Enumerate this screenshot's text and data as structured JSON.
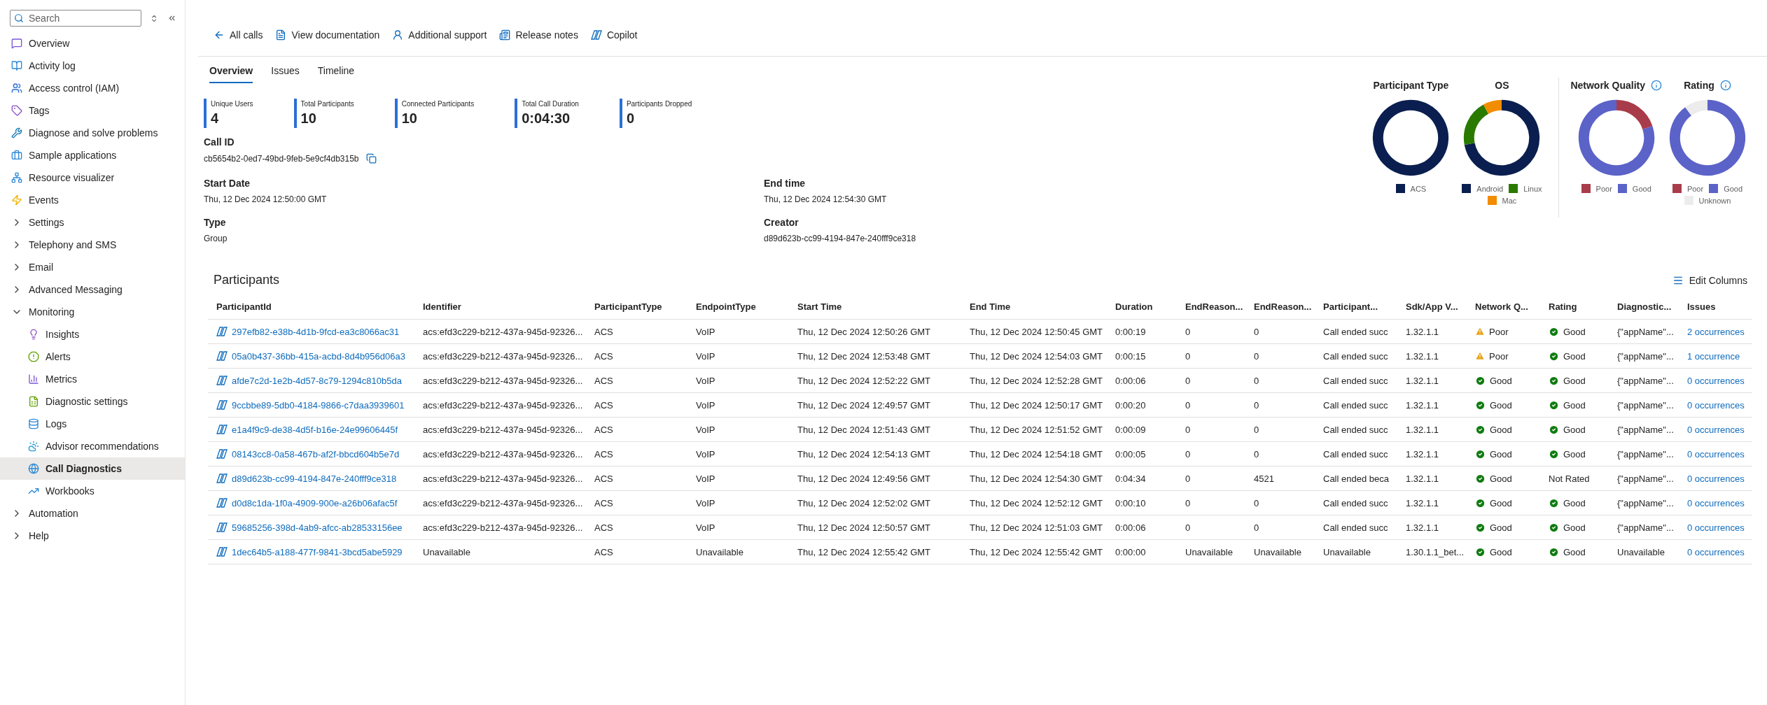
{
  "sidebar": {
    "search": {
      "placeholder": "Search"
    },
    "items": [
      {
        "label": "Overview",
        "kind": "link",
        "selected": false
      },
      {
        "label": "Activity log",
        "kind": "link",
        "selected": false
      },
      {
        "label": "Access control (IAM)",
        "kind": "link",
        "selected": false
      },
      {
        "label": "Tags",
        "kind": "link",
        "selected": false
      },
      {
        "label": "Diagnose and solve problems",
        "kind": "link",
        "selected": false
      },
      {
        "label": "Sample applications",
        "kind": "link",
        "selected": false
      },
      {
        "label": "Resource visualizer",
        "kind": "link",
        "selected": false
      },
      {
        "label": "Events",
        "kind": "link",
        "selected": false
      },
      {
        "label": "Settings",
        "kind": "group",
        "expanded": false,
        "selected": false
      },
      {
        "label": "Telephony and SMS",
        "kind": "group",
        "expanded": false,
        "selected": false
      },
      {
        "label": "Email",
        "kind": "group",
        "expanded": false,
        "selected": false
      },
      {
        "label": "Advanced Messaging",
        "kind": "group",
        "expanded": false,
        "selected": false
      },
      {
        "label": "Monitoring",
        "kind": "group",
        "expanded": true,
        "selected": false,
        "children": [
          {
            "label": "Insights",
            "kind": "link",
            "selected": false
          },
          {
            "label": "Alerts",
            "kind": "link",
            "selected": false
          },
          {
            "label": "Metrics",
            "kind": "link",
            "selected": false
          },
          {
            "label": "Diagnostic settings",
            "kind": "link",
            "selected": false
          },
          {
            "label": "Logs",
            "kind": "link",
            "selected": false
          },
          {
            "label": "Advisor recommendations",
            "kind": "link",
            "selected": false
          },
          {
            "label": "Call Diagnostics",
            "kind": "link",
            "selected": true
          },
          {
            "label": "Workbooks",
            "kind": "link",
            "selected": false
          }
        ]
      },
      {
        "label": "Automation",
        "kind": "group",
        "expanded": false,
        "selected": false
      },
      {
        "label": "Help",
        "kind": "group",
        "expanded": false,
        "selected": false
      }
    ]
  },
  "toolbar": [
    "All calls",
    "View documentation",
    "Additional support",
    "Release notes",
    "Copilot"
  ],
  "tabs": [
    {
      "label": "Overview",
      "selected": true
    },
    {
      "label": "Issues",
      "selected": false
    },
    {
      "label": "Timeline",
      "selected": false
    }
  ],
  "kpis": [
    {
      "label": "Unique Users",
      "value": "4"
    },
    {
      "label": "Total Participants",
      "value": "10"
    },
    {
      "label": "Connected Participants",
      "value": "10"
    },
    {
      "label": "Total Call Duration",
      "value": "0:04:30"
    },
    {
      "label": "Participants Dropped",
      "value": "0"
    }
  ],
  "call_id": {
    "label": "Call ID",
    "value": "cb5654b2-0ed7-49bd-9feb-5e9cf4db315b"
  },
  "details": [
    {
      "label": "Start Date",
      "value": "Thu, 12 Dec 2024 12:50:00 GMT"
    },
    {
      "label": "End time",
      "value": "Thu, 12 Dec 2024 12:54:30 GMT"
    },
    {
      "label": "Type",
      "value": "Group"
    },
    {
      "label": "Creator",
      "value": "d89d623b-cc99-4194-847e-240fff9ce318"
    }
  ],
  "charts": [
    {
      "title": "Participant Type",
      "info_icon": false,
      "legend": [
        {
          "label": "ACS",
          "color": "#0a1f4f"
        }
      ]
    },
    {
      "title": "OS",
      "info_icon": false,
      "legend": [
        {
          "label": "Android",
          "color": "#0a1f4f"
        },
        {
          "label": "Linux",
          "color": "#2a7a00"
        },
        {
          "label": "Mac",
          "color": "#f28c00"
        }
      ]
    },
    {
      "title": "Network Quality",
      "info_icon": true,
      "legend": [
        {
          "label": "Poor",
          "color": "#a93c4a"
        },
        {
          "label": "Good",
          "color": "#5b62c8"
        }
      ]
    },
    {
      "title": "Rating",
      "info_icon": true,
      "legend": [
        {
          "label": "Poor",
          "color": "#a93c4a"
        },
        {
          "label": "Good",
          "color": "#5b62c8"
        },
        {
          "label": "Unknown",
          "color": "#ececec"
        }
      ]
    }
  ],
  "participants": {
    "title": "Participants",
    "edit_columns": "Edit Columns",
    "columns": [
      "ParticipantId",
      "Identifier",
      "ParticipantType",
      "EndpointType",
      "Start Time",
      "End Time",
      "Duration",
      "EndReason...",
      "EndReason...",
      "Participant...",
      "Sdk/App V...",
      "Network Q...",
      "Rating",
      "Diagnostic...",
      "Issues"
    ],
    "rows": [
      {
        "id": "297efb82-e38b-4d1b-9fcd-ea3c8066ac31",
        "identifier": "acs:efd3c229-b212-437a-945d-92326...",
        "type": "ACS",
        "endpoint": "VoIP",
        "start": "Thu, 12 Dec 2024 12:50:26 GMT",
        "end": "Thu, 12 Dec 2024 12:50:45 GMT",
        "duration": "0:00:19",
        "reason_1": "0",
        "reason_2": "0",
        "participant": "Call ended succ",
        "sdk": "1.32.1.1",
        "network": {
          "text": "Poor",
          "kind": "warning"
        },
        "rating": {
          "text": "Good",
          "kind": "ok"
        },
        "diagnostic": "{\"appName\"...",
        "issues": "2 occurrences"
      },
      {
        "id": "05a0b437-36bb-415a-acbd-8d4b956d06a3",
        "identifier": "acs:efd3c229-b212-437a-945d-92326...",
        "type": "ACS",
        "endpoint": "VoIP",
        "start": "Thu, 12 Dec 2024 12:53:48 GMT",
        "end": "Thu, 12 Dec 2024 12:54:03 GMT",
        "duration": "0:00:15",
        "reason_1": "0",
        "reason_2": "0",
        "participant": "Call ended succ",
        "sdk": "1.32.1.1",
        "network": {
          "text": "Poor",
          "kind": "warning"
        },
        "rating": {
          "text": "Good",
          "kind": "ok"
        },
        "diagnostic": "{\"appName\"...",
        "issues": "1 occurrence"
      },
      {
        "id": "afde7c2d-1e2b-4d57-8c79-1294c810b5da",
        "identifier": "acs:efd3c229-b212-437a-945d-92326...",
        "type": "ACS",
        "endpoint": "VoIP",
        "start": "Thu, 12 Dec 2024 12:52:22 GMT",
        "end": "Thu, 12 Dec 2024 12:52:28 GMT",
        "duration": "0:00:06",
        "reason_1": "0",
        "reason_2": "0",
        "participant": "Call ended succ",
        "sdk": "1.32.1.1",
        "network": {
          "text": "Good",
          "kind": "ok"
        },
        "rating": {
          "text": "Good",
          "kind": "ok"
        },
        "diagnostic": "{\"appName\"...",
        "issues": "0 occurrences"
      },
      {
        "id": "9ccbbe89-5db0-4184-9866-c7daa3939601",
        "identifier": "acs:efd3c229-b212-437a-945d-92326...",
        "type": "ACS",
        "endpoint": "VoIP",
        "start": "Thu, 12 Dec 2024 12:49:57 GMT",
        "end": "Thu, 12 Dec 2024 12:50:17 GMT",
        "duration": "0:00:20",
        "reason_1": "0",
        "reason_2": "0",
        "participant": "Call ended succ",
        "sdk": "1.32.1.1",
        "network": {
          "text": "Good",
          "kind": "ok"
        },
        "rating": {
          "text": "Good",
          "kind": "ok"
        },
        "diagnostic": "{\"appName\"...",
        "issues": "0 occurrences"
      },
      {
        "id": "e1a4f9c9-de38-4d5f-b16e-24e99606445f",
        "identifier": "acs:efd3c229-b212-437a-945d-92326...",
        "type": "ACS",
        "endpoint": "VoIP",
        "start": "Thu, 12 Dec 2024 12:51:43 GMT",
        "end": "Thu, 12 Dec 2024 12:51:52 GMT",
        "duration": "0:00:09",
        "reason_1": "0",
        "reason_2": "0",
        "participant": "Call ended succ",
        "sdk": "1.32.1.1",
        "network": {
          "text": "Good",
          "kind": "ok"
        },
        "rating": {
          "text": "Good",
          "kind": "ok"
        },
        "diagnostic": "{\"appName\"...",
        "issues": "0 occurrences"
      },
      {
        "id": "08143cc8-0a58-467b-af2f-bbcd604b5e7d",
        "identifier": "acs:efd3c229-b212-437a-945d-92326...",
        "type": "ACS",
        "endpoint": "VoIP",
        "start": "Thu, 12 Dec 2024 12:54:13 GMT",
        "end": "Thu, 12 Dec 2024 12:54:18 GMT",
        "duration": "0:00:05",
        "reason_1": "0",
        "reason_2": "0",
        "participant": "Call ended succ",
        "sdk": "1.32.1.1",
        "network": {
          "text": "Good",
          "kind": "ok"
        },
        "rating": {
          "text": "Good",
          "kind": "ok"
        },
        "diagnostic": "{\"appName\"...",
        "issues": "0 occurrences"
      },
      {
        "id": "d89d623b-cc99-4194-847e-240fff9ce318",
        "identifier": "acs:efd3c229-b212-437a-945d-92326...",
        "type": "ACS",
        "endpoint": "VoIP",
        "start": "Thu, 12 Dec 2024 12:49:56 GMT",
        "end": "Thu, 12 Dec 2024 12:54:30 GMT",
        "duration": "0:04:34",
        "reason_1": "0",
        "reason_2": "4521",
        "participant": "Call ended beca",
        "sdk": "1.32.1.1",
        "network": {
          "text": "Good",
          "kind": "ok"
        },
        "rating": {
          "text": "Not Rated",
          "kind": "none"
        },
        "diagnostic": "{\"appName\"...",
        "issues": "0 occurrences"
      },
      {
        "id": "d0d8c1da-1f0a-4909-900e-a26b06afac5f",
        "identifier": "acs:efd3c229-b212-437a-945d-92326...",
        "type": "ACS",
        "endpoint": "VoIP",
        "start": "Thu, 12 Dec 2024 12:52:02 GMT",
        "end": "Thu, 12 Dec 2024 12:52:12 GMT",
        "duration": "0:00:10",
        "reason_1": "0",
        "reason_2": "0",
        "participant": "Call ended succ",
        "sdk": "1.32.1.1",
        "network": {
          "text": "Good",
          "kind": "ok"
        },
        "rating": {
          "text": "Good",
          "kind": "ok"
        },
        "diagnostic": "{\"appName\"...",
        "issues": "0 occurrences"
      },
      {
        "id": "59685256-398d-4ab9-afcc-ab28533156ee",
        "identifier": "acs:efd3c229-b212-437a-945d-92326...",
        "type": "ACS",
        "endpoint": "VoIP",
        "start": "Thu, 12 Dec 2024 12:50:57 GMT",
        "end": "Thu, 12 Dec 2024 12:51:03 GMT",
        "duration": "0:00:06",
        "reason_1": "0",
        "reason_2": "0",
        "participant": "Call ended succ",
        "sdk": "1.32.1.1",
        "network": {
          "text": "Good",
          "kind": "ok"
        },
        "rating": {
          "text": "Good",
          "kind": "ok"
        },
        "diagnostic": "{\"appName\"...",
        "issues": "0 occurrences"
      },
      {
        "id": "1dec64b5-a188-477f-9841-3bcd5abe5929",
        "identifier": "Unavailable",
        "type": "ACS",
        "endpoint": "Unavailable",
        "start": "Thu, 12 Dec 2024 12:55:42 GMT",
        "end": "Thu, 12 Dec 2024 12:55:42 GMT",
        "duration": "0:00:00",
        "reason_1": "Unavailable",
        "reason_2": "Unavailable",
        "participant": "Unavailable",
        "sdk": "1.30.1.1_bet...",
        "network": {
          "text": "Good",
          "kind": "ok"
        },
        "rating": {
          "text": "Good",
          "kind": "ok"
        },
        "diagnostic": "Unavailable",
        "issues": "0 occurrences"
      }
    ]
  }
}
